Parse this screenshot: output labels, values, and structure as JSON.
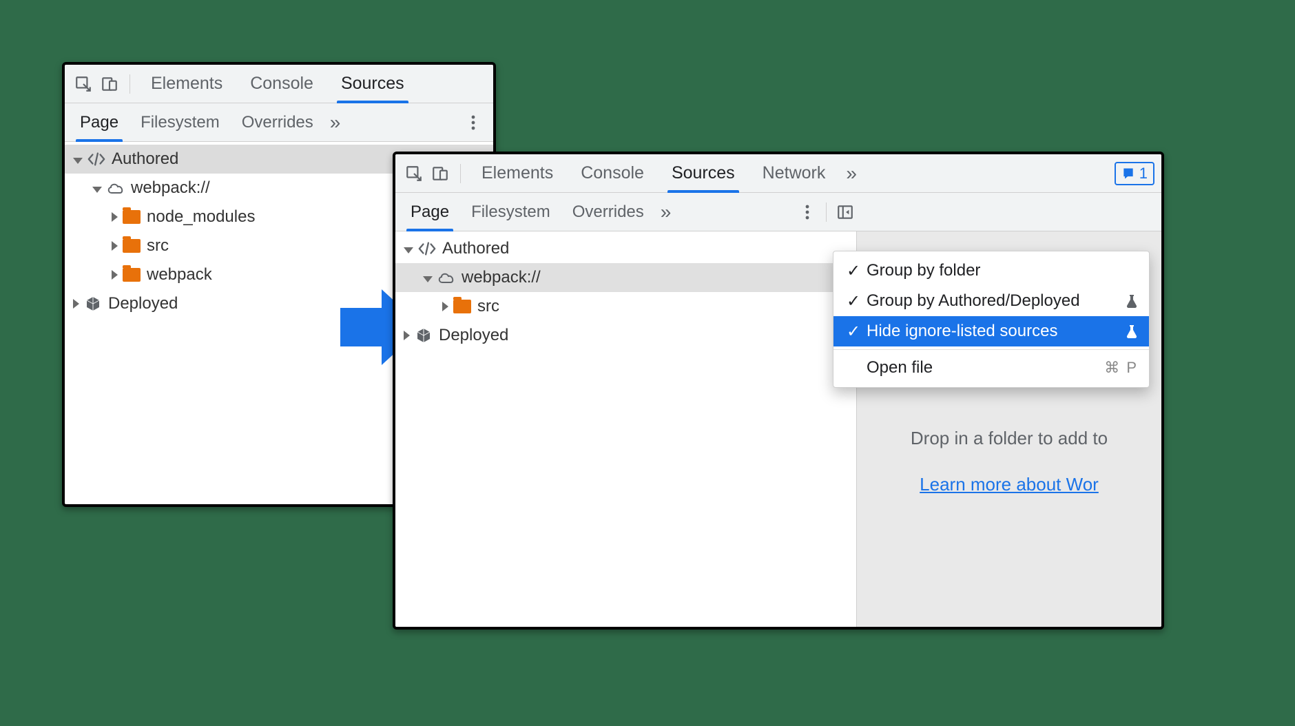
{
  "left_panel": {
    "main_tabs": {
      "elements": "Elements",
      "console": "Console",
      "sources": "Sources"
    },
    "sub_tabs": {
      "page": "Page",
      "filesystem": "Filesystem",
      "overrides": "Overrides"
    },
    "tree": {
      "authored": "Authored",
      "webpack": "webpack://",
      "node_modules": "node_modules",
      "src": "src",
      "webpack_folder": "webpack",
      "deployed": "Deployed"
    }
  },
  "right_panel": {
    "main_tabs": {
      "elements": "Elements",
      "console": "Console",
      "sources": "Sources",
      "network": "Network"
    },
    "issues_count": "1",
    "sub_tabs": {
      "page": "Page",
      "filesystem": "Filesystem",
      "overrides": "Overrides"
    },
    "tree": {
      "authored": "Authored",
      "webpack": "webpack://",
      "src": "src",
      "deployed": "Deployed"
    },
    "hint": {
      "drop": "Drop in a folder to add to",
      "learn": "Learn more about Wor"
    }
  },
  "context_menu": {
    "group_by_folder": "Group by folder",
    "group_by_authored": "Group by Authored/Deployed",
    "hide_ignore": "Hide ignore-listed sources",
    "open_file": "Open file",
    "open_file_shortcut": "⌘ P"
  }
}
